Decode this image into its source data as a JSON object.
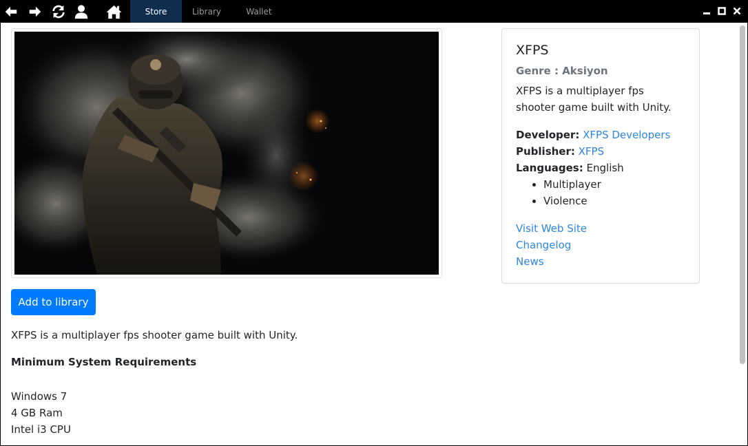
{
  "topbar": {
    "nav": [
      "back-icon",
      "forward-icon",
      "refresh-icon",
      "user-icon",
      "home-icon"
    ],
    "tabs": [
      {
        "label": "Store",
        "active": true
      },
      {
        "label": "Library",
        "active": false
      },
      {
        "label": "Wallet",
        "active": false
      }
    ],
    "window_controls": [
      "minimize-icon",
      "maximize-icon",
      "close-icon"
    ]
  },
  "main": {
    "add_button": "Add to library",
    "description": "XFPS is a multiplayer fps shooter game built with Unity.",
    "requirements_title": "Minimum System Requirements",
    "requirements": [
      "Windows 7",
      "4 GB Ram",
      "Intel i3 CPU"
    ]
  },
  "card": {
    "title": "XFPS",
    "genre": "Genre : Aksiyon",
    "description": "XFPS is a multiplayer fps shooter game built with Unity.",
    "developer_label": "Developer:",
    "developer": "XFPS Developers",
    "publisher_label": "Publisher:",
    "publisher": "XFPS",
    "languages_label": "Languages:",
    "languages": "English",
    "tags": [
      "Multiplayer",
      "Violence"
    ],
    "links": [
      "Visit Web Site",
      "Changelog",
      "News"
    ]
  },
  "colors": {
    "accent": "#007bff",
    "link": "#2d86e3",
    "active_tab": "#0e2d4f",
    "muted": "#6c757d"
  }
}
